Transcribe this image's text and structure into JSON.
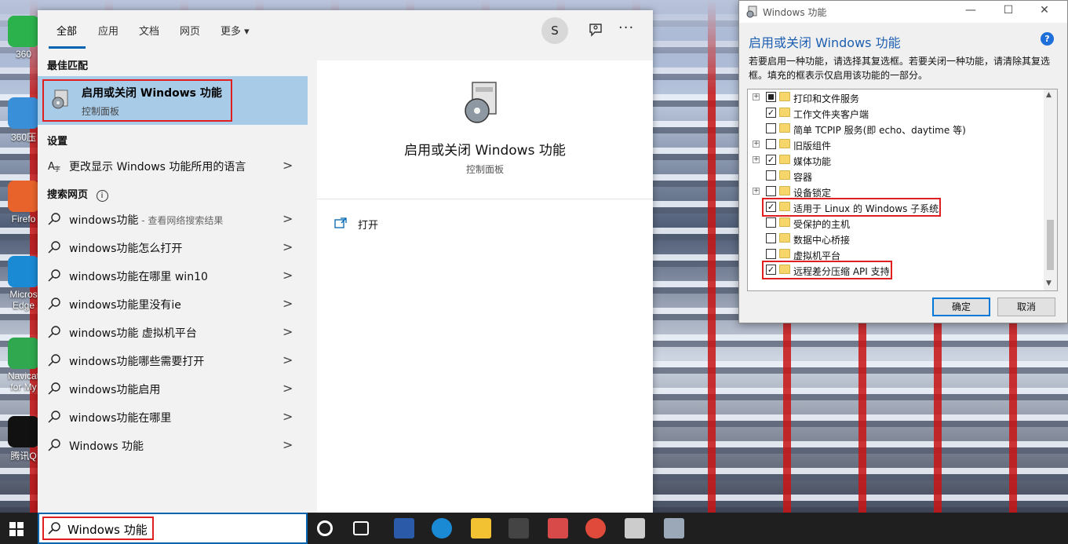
{
  "desktop": {
    "icons": [
      {
        "label": "360",
        "color": "#2bb24c"
      },
      {
        "label": "360压",
        "color": "#3a8fd9"
      },
      {
        "label": "Firefo",
        "color": "#e8632b"
      },
      {
        "label": "Micros Edge",
        "color": "#1a8ad4"
      },
      {
        "label": "Navicat for My",
        "color": "#2fa84f"
      },
      {
        "label": "腾讯Q",
        "color": "#111111"
      }
    ]
  },
  "search_panel": {
    "tabs": [
      {
        "label": "全部"
      },
      {
        "label": "应用"
      },
      {
        "label": "文档"
      },
      {
        "label": "网页"
      },
      {
        "label": "更多 ▾"
      }
    ],
    "avatar_initial": "S",
    "sections": {
      "best_match": "最佳匹配",
      "settings": "设置",
      "web": "搜索网页"
    },
    "best_match": {
      "title": "启用或关闭 Windows 功能",
      "subtitle": "控制面板"
    },
    "settings_item": {
      "label": "更改显示 Windows 功能所用的语言"
    },
    "web_results": [
      {
        "label": "windows功能",
        "suffix": " - 查看网络搜索结果"
      },
      {
        "label": "windows功能怎么打开",
        "suffix": ""
      },
      {
        "label": "windows功能在哪里 win10",
        "suffix": ""
      },
      {
        "label": "windows功能里没有ie",
        "suffix": ""
      },
      {
        "label": "windows功能 虚拟机平台",
        "suffix": ""
      },
      {
        "label": "windows功能哪些需要打开",
        "suffix": ""
      },
      {
        "label": "windows功能启用",
        "suffix": ""
      },
      {
        "label": "windows功能在哪里",
        "suffix": ""
      },
      {
        "label": "Windows 功能",
        "suffix": ""
      }
    ],
    "preview": {
      "title": "启用或关闭 Windows 功能",
      "subtitle": "控制面板",
      "open_label": "打开"
    }
  },
  "dialog": {
    "window_title": "Windows 功能",
    "header": "启用或关闭 Windows 功能",
    "help_label": "?",
    "description": "若要启用一种功能，请选择其复选框。若要关闭一种功能，请清除其复选框。填充的框表示仅启用该功能的一部分。",
    "features": [
      {
        "label": "打印和文件服务",
        "state": "partial",
        "expandable": true,
        "highlight": false
      },
      {
        "label": "工作文件夹客户端",
        "state": "checked",
        "expandable": false,
        "highlight": false
      },
      {
        "label": "简单 TCPIP 服务(即 echo、daytime 等)",
        "state": "unchecked",
        "expandable": false,
        "highlight": false
      },
      {
        "label": "旧版组件",
        "state": "unchecked",
        "expandable": true,
        "highlight": false
      },
      {
        "label": "媒体功能",
        "state": "checked",
        "expandable": true,
        "highlight": false
      },
      {
        "label": "容器",
        "state": "unchecked",
        "expandable": false,
        "highlight": false
      },
      {
        "label": "设备锁定",
        "state": "unchecked",
        "expandable": true,
        "highlight": false
      },
      {
        "label": "适用于 Linux 的 Windows 子系统",
        "state": "checked",
        "expandable": false,
        "highlight": true
      },
      {
        "label": "受保护的主机",
        "state": "unchecked",
        "expandable": false,
        "highlight": false
      },
      {
        "label": "数据中心桥接",
        "state": "unchecked",
        "expandable": false,
        "highlight": false
      },
      {
        "label": "虚拟机平台",
        "state": "unchecked",
        "expandable": false,
        "highlight": false
      },
      {
        "label": "远程差分压缩 API 支持",
        "state": "checked",
        "expandable": false,
        "highlight": true
      }
    ],
    "ok_label": "确定",
    "cancel_label": "取消"
  },
  "taskbar": {
    "search_value": "Windows 功能",
    "apps": [
      {
        "icon": "task-view-icon",
        "color": "#1f1f1f"
      },
      {
        "icon": "powershell-icon",
        "color": "#2a5aa8"
      },
      {
        "icon": "edge-icon",
        "color": "#1a8ad4"
      },
      {
        "icon": "file-explorer-icon",
        "color": "#f2c232"
      },
      {
        "icon": "store-icon",
        "color": "#444444"
      },
      {
        "icon": "app-icon",
        "color": "#d84a4a"
      },
      {
        "icon": "chrome-icon",
        "color": "#e04a3a"
      },
      {
        "icon": "settings-icon",
        "color": "#cccccc"
      },
      {
        "icon": "control-panel-icon",
        "color": "#9aa8b8"
      }
    ]
  },
  "colors": {
    "accent": "#0063b1",
    "highlight_red": "#e02020",
    "selection": "#a8cbe8"
  }
}
